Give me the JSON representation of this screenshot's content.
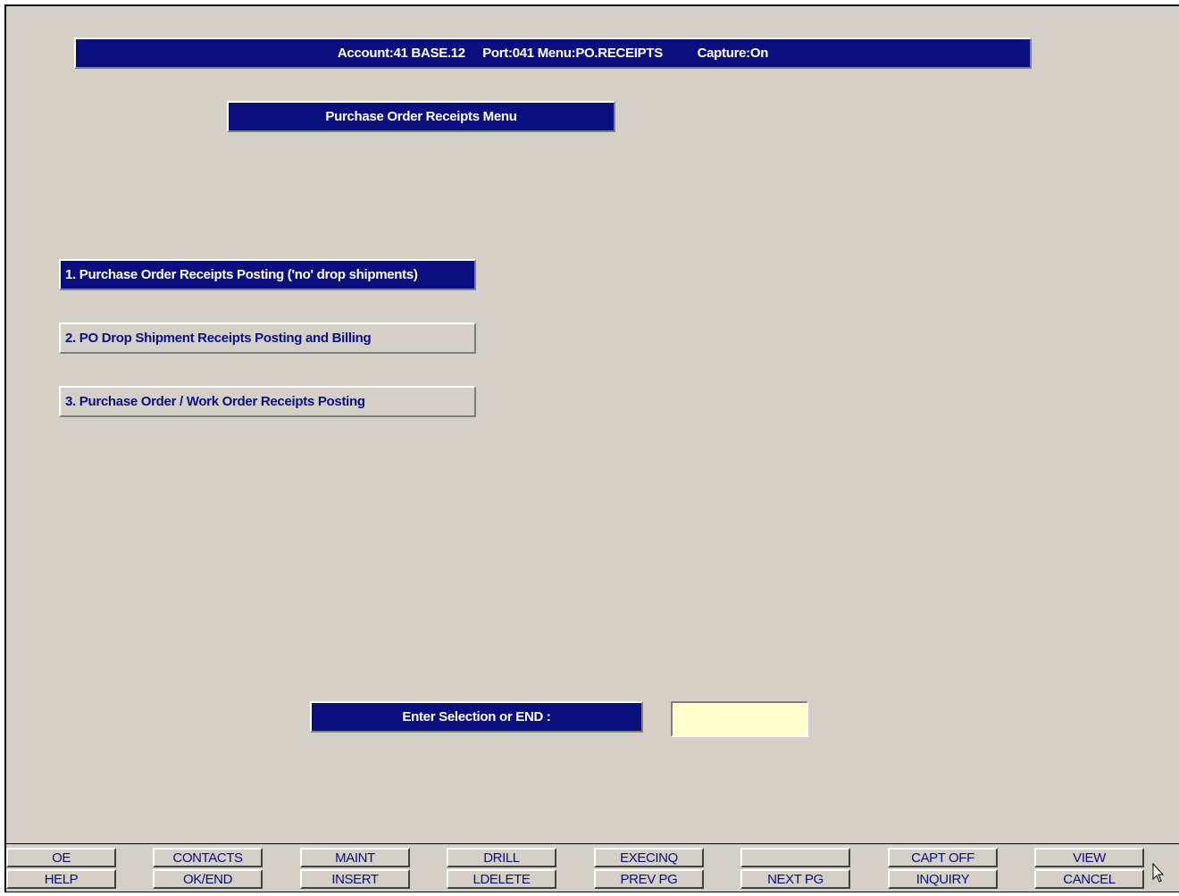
{
  "header": {
    "account": "Account:41 BASE.12",
    "port_menu": "Port:041 Menu:PO.RECEIPTS",
    "capture": "Capture:On"
  },
  "menu": {
    "title": "Purchase Order Receipts Menu",
    "options": [
      {
        "label": "1. Purchase Order Receipts Posting ('no' drop shipments)",
        "selected": true
      },
      {
        "label": "2. PO Drop Shipment Receipts Posting and Billing",
        "selected": false
      },
      {
        "label": "3. Purchase Order / Work Order Receipts Posting",
        "selected": false
      }
    ]
  },
  "prompt": {
    "label": "Enter Selection or END :",
    "value": ""
  },
  "function_keys": {
    "top": [
      "OE",
      "CONTACTS",
      "MAINT",
      "DRILL",
      "EXECINQ",
      "",
      "CAPT OFF",
      "VIEW"
    ],
    "bottom": [
      "HELP",
      "OK/END",
      "INSERT",
      "LDELETE",
      "PREV PG",
      "NEXT PG",
      "INQUIRY",
      "CANCEL"
    ]
  },
  "colors": {
    "bar_blue": "#0b0f7e",
    "background": "#d4d0c8",
    "input_yellow": "#ffffcc"
  },
  "icons": {
    "cursor": "mouse-pointer-icon"
  }
}
